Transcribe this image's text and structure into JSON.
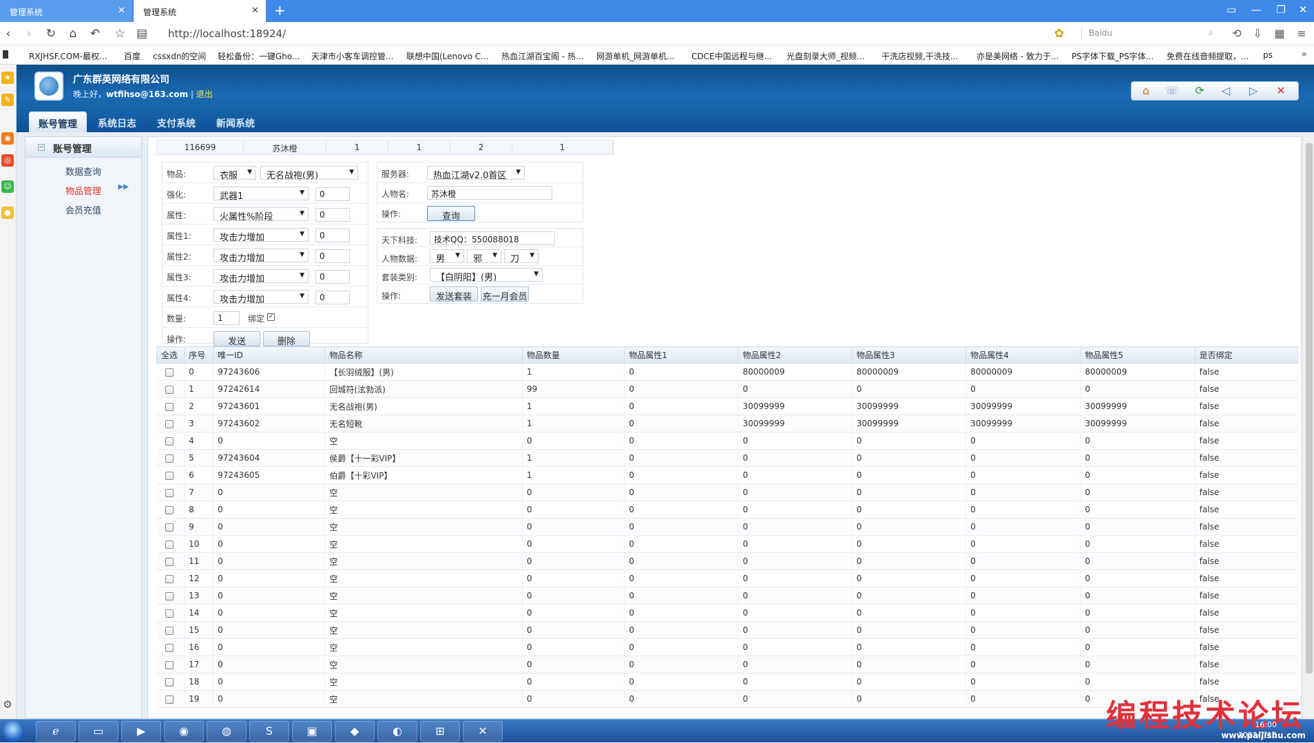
{
  "browser": {
    "tabs": [
      {
        "title": "管理系统"
      },
      {
        "title": "管理系统"
      }
    ],
    "new_tab": "+",
    "url": "http://localhost:18924/",
    "search_placeholder": "Baidu",
    "bookmarks": [
      "RXJHSF.COM-最权...",
      "百度",
      "cssxdn的空间",
      "轻松备份：一键Gho...",
      "天津市小客车调控管...",
      "联想中国(Lenovo C...",
      "热血江湖百宝阁 - 热...",
      "网游单机_网游单机...",
      "CDCE中国远程与继...",
      "光盘刻录大师_视频...",
      "干洗店视频,干洗技...",
      "亦是美网络 - 致力于...",
      "PS字体下载_PS字体...",
      "免费在线音频提取，...",
      "ps"
    ]
  },
  "header": {
    "company": "广东群英网络有限公司",
    "greeting": "晚上好，",
    "username": "wtfihso@163.com",
    "separator": "|",
    "logout": "退出",
    "tabs": [
      {
        "label": "账号管理"
      },
      {
        "label": "系统日志"
      },
      {
        "label": "支付系统"
      },
      {
        "label": "新闻系统"
      }
    ]
  },
  "sidebar": {
    "title": "账号管理",
    "items": [
      {
        "label": "数据查询"
      },
      {
        "label": "物品管理"
      },
      {
        "label": "会员充值"
      }
    ]
  },
  "info_row": [
    "116699",
    "苏沐橙",
    "1",
    "1",
    "2",
    "1"
  ],
  "item_form": {
    "item_label": "物品:",
    "item_type": "衣服",
    "item_name": "无名战袍(男)",
    "enhance_label": "强化:",
    "enhance_type": "武器1",
    "enhance_value": "0",
    "attr_label": "属性:",
    "attr_type": "火属性%阶段",
    "attr_value": "0",
    "attrs": [
      {
        "label": "属性1:",
        "type": "攻击力增加",
        "value": "0"
      },
      {
        "label": "属性2:",
        "type": "攻击力增加",
        "value": "0"
      },
      {
        "label": "属性3:",
        "type": "攻击力增加",
        "value": "0"
      },
      {
        "label": "属性4:",
        "type": "攻击力增加",
        "value": "0"
      }
    ],
    "qty_label": "数量:",
    "qty_value": "1",
    "bind_label": "绑定",
    "ops_label": "操作:",
    "send_label": "发送",
    "delete_label": "删除"
  },
  "query_form": {
    "server_label": "服务器:",
    "server_value": "热血江湖v2.0首区",
    "name_label": "人物名:",
    "name_value": "苏沐橙",
    "ops_label": "操作:",
    "query_label": "查询"
  },
  "suit_form": {
    "tech_label": "天下科技:",
    "tech_value": "技术QQ：550088018",
    "char_label": "人物数据:",
    "gender": "男",
    "faction": "邪",
    "weapon": "刀",
    "suit_label": "套装类别:",
    "suit_value": "【白阴阳】(男)",
    "ops_label": "操作:",
    "send_suit_label": "发送套装",
    "vip_label": "充一月会员"
  },
  "table": {
    "headers": [
      "全选",
      "序号",
      "唯一ID",
      "物品名称",
      "物品数量",
      "物品属性1",
      "物品属性2",
      "物品属性3",
      "物品属性4",
      "物品属性5",
      "是否绑定"
    ],
    "rows": [
      [
        "0",
        "97243606",
        "【长羽绒服】(男)",
        "1",
        "0",
        "80000009",
        "80000009",
        "80000009",
        "80000009",
        "false"
      ],
      [
        "1",
        "97242614",
        "回城符(泫勃派)",
        "99",
        "0",
        "0",
        "0",
        "0",
        "0",
        "false"
      ],
      [
        "2",
        "97243601",
        "无名战袍(男)",
        "1",
        "0",
        "30099999",
        "30099999",
        "30099999",
        "30099999",
        "false"
      ],
      [
        "3",
        "97243602",
        "无名短靴",
        "1",
        "0",
        "30099999",
        "30099999",
        "30099999",
        "30099999",
        "false"
      ],
      [
        "4",
        "0",
        "空",
        "0",
        "0",
        "0",
        "0",
        "0",
        "0",
        "false"
      ],
      [
        "5",
        "97243604",
        "侯爵【十一彩VIP】",
        "1",
        "0",
        "0",
        "0",
        "0",
        "0",
        "false"
      ],
      [
        "6",
        "97243605",
        "伯爵【十彩VIP】",
        "1",
        "0",
        "0",
        "0",
        "0",
        "0",
        "false"
      ],
      [
        "7",
        "0",
        "空",
        "0",
        "0",
        "0",
        "0",
        "0",
        "0",
        "false"
      ],
      [
        "8",
        "0",
        "空",
        "0",
        "0",
        "0",
        "0",
        "0",
        "0",
        "false"
      ],
      [
        "9",
        "0",
        "空",
        "0",
        "0",
        "0",
        "0",
        "0",
        "0",
        "false"
      ],
      [
        "10",
        "0",
        "空",
        "0",
        "0",
        "0",
        "0",
        "0",
        "0",
        "false"
      ],
      [
        "11",
        "0",
        "空",
        "0",
        "0",
        "0",
        "0",
        "0",
        "0",
        "false"
      ],
      [
        "12",
        "0",
        "空",
        "0",
        "0",
        "0",
        "0",
        "0",
        "0",
        "false"
      ],
      [
        "13",
        "0",
        "空",
        "0",
        "0",
        "0",
        "0",
        "0",
        "0",
        "false"
      ],
      [
        "14",
        "0",
        "空",
        "0",
        "0",
        "0",
        "0",
        "0",
        "0",
        "false"
      ],
      [
        "15",
        "0",
        "空",
        "0",
        "0",
        "0",
        "0",
        "0",
        "0",
        "false"
      ],
      [
        "16",
        "0",
        "空",
        "0",
        "0",
        "0",
        "0",
        "0",
        "0",
        "false"
      ],
      [
        "17",
        "0",
        "空",
        "0",
        "0",
        "0",
        "0",
        "0",
        "0",
        "false"
      ],
      [
        "18",
        "0",
        "空",
        "0",
        "0",
        "0",
        "0",
        "0",
        "0",
        "false"
      ],
      [
        "19",
        "0",
        "空",
        "0",
        "0",
        "0",
        "0",
        "0",
        "0",
        "false"
      ]
    ]
  },
  "taskbar": {
    "time": "16:00",
    "date": "2022/7/18",
    "watermark": "编程技术论坛",
    "watermark_url": "www.paijishu.com"
  }
}
